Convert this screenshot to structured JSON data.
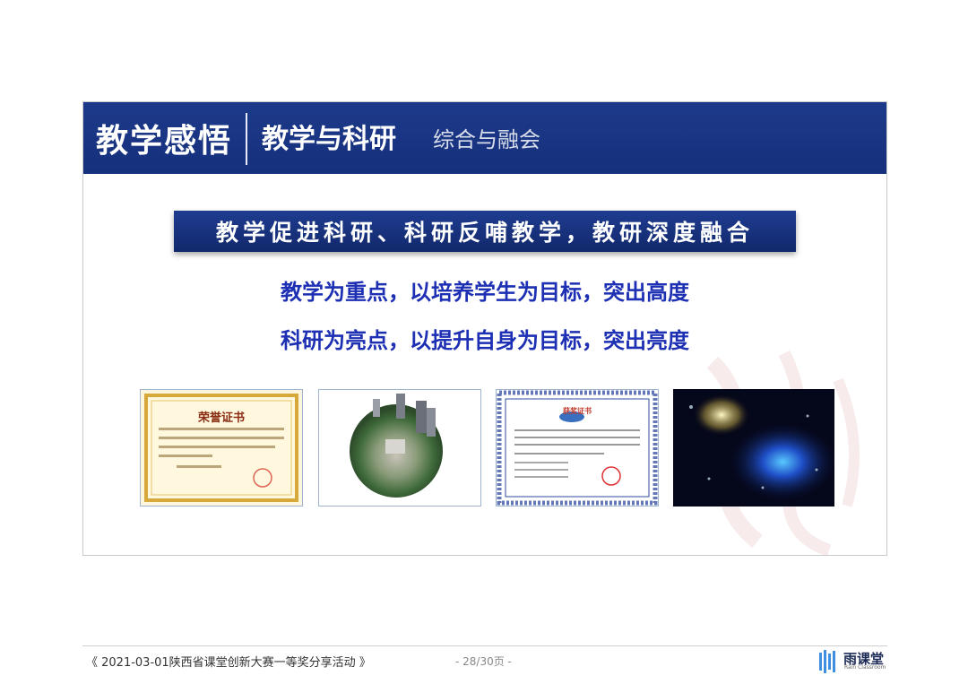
{
  "slide": {
    "header": {
      "title": "教学感悟",
      "subtitle": "教学与科研",
      "subtitle2": "综合与融会"
    },
    "banner_text": "教学促进科研、科研反哺教学，教研深度融合",
    "line1": "教学为重点，以培养学生为目标，突出高度",
    "line2": "科研为亮点，以提升自身为目标，突出亮度",
    "images": {
      "cert1_title": "荣誉证书",
      "cert2_title": "获奖证书"
    }
  },
  "footer": {
    "event_text": "《 2021-03-01陕西省课堂创新大赛一等奖分享活动 》",
    "page_text": "- 28/30页 -",
    "logo_name": "雨课堂",
    "logo_sub": "Rain Classroom"
  },
  "colors": {
    "header_bg": "#15307c",
    "text_blue": "#1d2fb3"
  }
}
